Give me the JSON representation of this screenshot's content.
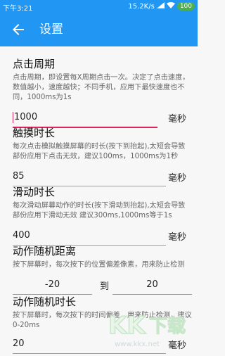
{
  "status": {
    "time": "下午3:21",
    "speed": "15.2K/s",
    "battery": "100"
  },
  "appbar": {
    "title": "设置"
  },
  "sections": [
    {
      "title": "点击周期",
      "desc": "点击周期，即设置每X周期点击一次。决定了点击速度，数值越小，速度越快；不同手机，应用下最快速度也不同，1000ms为1s",
      "value": "1000",
      "unit": "毫秒"
    },
    {
      "title": "触摸时长",
      "desc": "每次点击模拟触摸屏幕的时长(按下到抬起),太短会导致部份应用下点击无效，建议100ms，1000ms为1秒",
      "value": "85",
      "unit": "毫秒"
    },
    {
      "title": "滑动时长",
      "desc": "每次滑动屏幕动作的时长(按下滑动到抬起),太短会导致部份应用下滑动无效 建议300ms,1000ms等于1s",
      "value": "400",
      "unit": "毫秒"
    },
    {
      "title": "动作随机距离",
      "desc": "按下屏幕时，每次按下的位置偏差像素，用来防止检测",
      "min": "-20",
      "to": "到",
      "max": "20"
    },
    {
      "title": "动作随机时长",
      "desc": "按下屏幕时，每次按下的时间偏差，用来防止检测，建议0-20ms",
      "value": "20",
      "unit": "毫秒"
    }
  ],
  "watermark": {
    "logo": "KK下载",
    "url": "www.kkx.net"
  }
}
